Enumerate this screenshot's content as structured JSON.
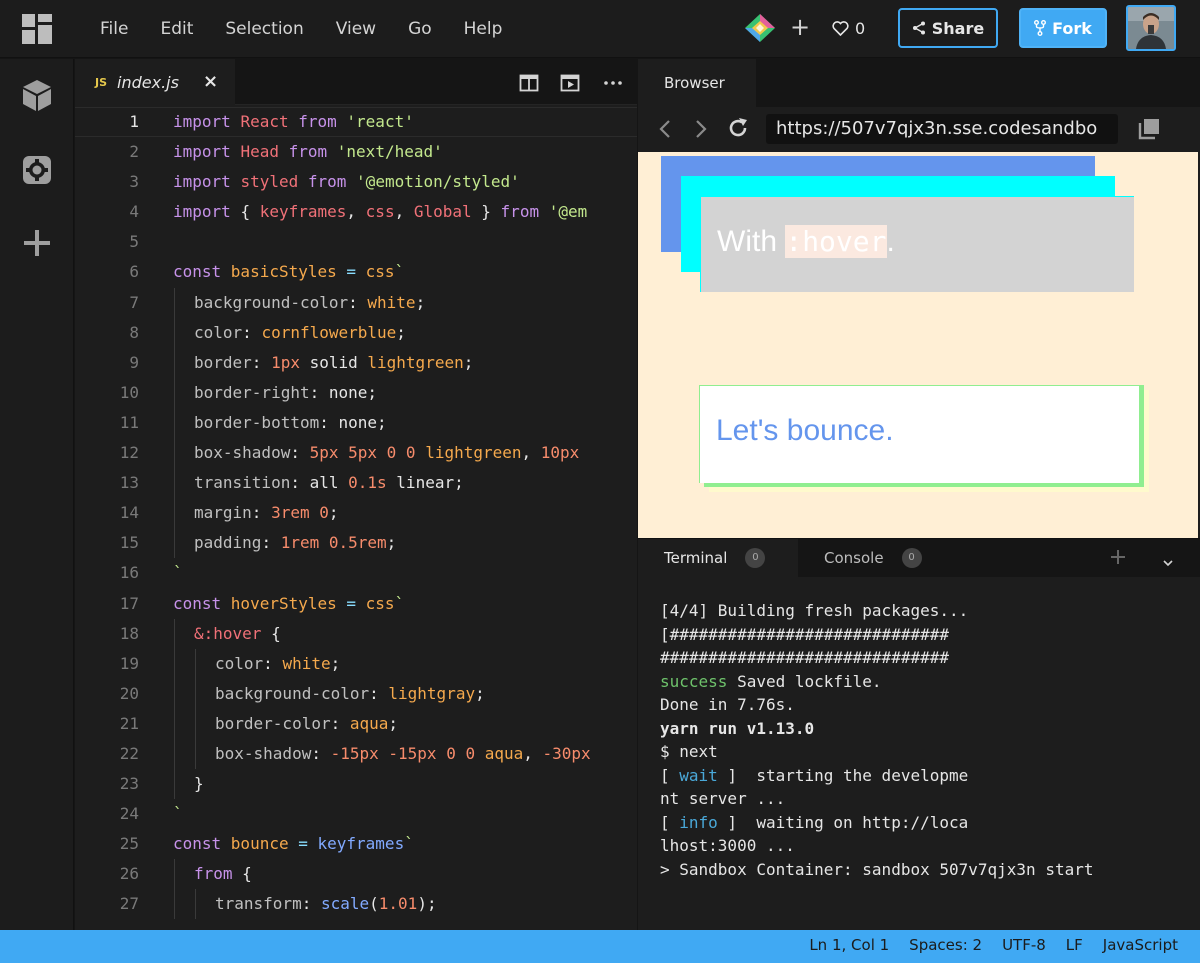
{
  "menu": [
    "File",
    "Edit",
    "Selection",
    "View",
    "Go",
    "Help"
  ],
  "header": {
    "plus": "+",
    "likes": "0",
    "share_label": "Share",
    "fork_label": "Fork"
  },
  "editor": {
    "tab": {
      "badge": "JS",
      "filename": "index.js",
      "close": "×"
    },
    "active_line": 1,
    "lines": [
      {
        "n": "1",
        "tokens": [
          {
            "c": "k",
            "t": "import "
          },
          {
            "c": "v",
            "t": "React "
          },
          {
            "c": "k",
            "t": "from "
          },
          {
            "c": "s",
            "t": "'react'"
          }
        ]
      },
      {
        "n": "2",
        "tokens": [
          {
            "c": "k",
            "t": "import "
          },
          {
            "c": "v",
            "t": "Head "
          },
          {
            "c": "k",
            "t": "from "
          },
          {
            "c": "s",
            "t": "'next/head'"
          }
        ]
      },
      {
        "n": "3",
        "tokens": [
          {
            "c": "k",
            "t": "import "
          },
          {
            "c": "v",
            "t": "styled "
          },
          {
            "c": "k",
            "t": "from "
          },
          {
            "c": "s",
            "t": "'@emotion/styled'"
          }
        ]
      },
      {
        "n": "4",
        "tokens": [
          {
            "c": "k",
            "t": "import "
          },
          {
            "c": "p",
            "t": "{ "
          },
          {
            "c": "v",
            "t": "keyframes"
          },
          {
            "c": "p",
            "t": ", "
          },
          {
            "c": "v",
            "t": "css"
          },
          {
            "c": "p",
            "t": ", "
          },
          {
            "c": "v",
            "t": "Global "
          },
          {
            "c": "p",
            "t": "} "
          },
          {
            "c": "k",
            "t": "from "
          },
          {
            "c": "s",
            "t": "'@em"
          }
        ]
      },
      {
        "n": "5",
        "tokens": []
      },
      {
        "n": "6",
        "tokens": [
          {
            "c": "k",
            "t": "const "
          },
          {
            "c": "val",
            "t": "basicStyles "
          },
          {
            "c": "o",
            "t": "= "
          },
          {
            "c": "val",
            "t": "css"
          },
          {
            "c": "s",
            "t": "`"
          }
        ]
      },
      {
        "n": "7",
        "indent": 1,
        "tokens": [
          {
            "c": "pr",
            "t": "background-color"
          },
          {
            "c": "p",
            "t": ": "
          },
          {
            "c": "val",
            "t": "white"
          },
          {
            "c": "p",
            "t": ";"
          }
        ]
      },
      {
        "n": "8",
        "indent": 1,
        "tokens": [
          {
            "c": "pr",
            "t": "color"
          },
          {
            "c": "p",
            "t": ": "
          },
          {
            "c": "val",
            "t": "cornflowerblue"
          },
          {
            "c": "p",
            "t": ";"
          }
        ]
      },
      {
        "n": "9",
        "indent": 1,
        "tokens": [
          {
            "c": "pr",
            "t": "border"
          },
          {
            "c": "p",
            "t": ": "
          },
          {
            "c": "n",
            "t": "1px "
          },
          {
            "c": "p",
            "t": "solid "
          },
          {
            "c": "val",
            "t": "lightgreen"
          },
          {
            "c": "p",
            "t": ";"
          }
        ]
      },
      {
        "n": "10",
        "indent": 1,
        "tokens": [
          {
            "c": "pr",
            "t": "border-right"
          },
          {
            "c": "p",
            "t": ": none;"
          }
        ]
      },
      {
        "n": "11",
        "indent": 1,
        "tokens": [
          {
            "c": "pr",
            "t": "border-bottom"
          },
          {
            "c": "p",
            "t": ": none;"
          }
        ]
      },
      {
        "n": "12",
        "indent": 1,
        "tokens": [
          {
            "c": "pr",
            "t": "box-shadow"
          },
          {
            "c": "p",
            "t": ": "
          },
          {
            "c": "n",
            "t": "5px 5px 0 0 "
          },
          {
            "c": "val",
            "t": "lightgreen"
          },
          {
            "c": "p",
            "t": ", "
          },
          {
            "c": "n",
            "t": "10px"
          }
        ]
      },
      {
        "n": "13",
        "indent": 1,
        "tokens": [
          {
            "c": "pr",
            "t": "transition"
          },
          {
            "c": "p",
            "t": ": all "
          },
          {
            "c": "n",
            "t": "0.1s "
          },
          {
            "c": "p",
            "t": "linear;"
          }
        ]
      },
      {
        "n": "14",
        "indent": 1,
        "tokens": [
          {
            "c": "pr",
            "t": "margin"
          },
          {
            "c": "p",
            "t": ": "
          },
          {
            "c": "n",
            "t": "3rem 0"
          },
          {
            "c": "p",
            "t": ";"
          }
        ]
      },
      {
        "n": "15",
        "indent": 1,
        "tokens": [
          {
            "c": "pr",
            "t": "padding"
          },
          {
            "c": "p",
            "t": ": "
          },
          {
            "c": "n",
            "t": "1rem 0.5rem"
          },
          {
            "c": "p",
            "t": ";"
          }
        ]
      },
      {
        "n": "16",
        "tokens": [
          {
            "c": "s",
            "t": "`"
          }
        ]
      },
      {
        "n": "17",
        "tokens": [
          {
            "c": "k",
            "t": "const "
          },
          {
            "c": "val",
            "t": "hoverStyles "
          },
          {
            "c": "o",
            "t": "= "
          },
          {
            "c": "val",
            "t": "css"
          },
          {
            "c": "s",
            "t": "`"
          }
        ]
      },
      {
        "n": "18",
        "indent": 1,
        "tokens": [
          {
            "c": "v",
            "t": "&:hover "
          },
          {
            "c": "p",
            "t": "{"
          }
        ]
      },
      {
        "n": "19",
        "indent": 2,
        "tokens": [
          {
            "c": "pr",
            "t": "color"
          },
          {
            "c": "p",
            "t": ": "
          },
          {
            "c": "val",
            "t": "white"
          },
          {
            "c": "p",
            "t": ";"
          }
        ]
      },
      {
        "n": "20",
        "indent": 2,
        "tokens": [
          {
            "c": "pr",
            "t": "background-color"
          },
          {
            "c": "p",
            "t": ": "
          },
          {
            "c": "val",
            "t": "lightgray"
          },
          {
            "c": "p",
            "t": ";"
          }
        ]
      },
      {
        "n": "21",
        "indent": 2,
        "tokens": [
          {
            "c": "pr",
            "t": "border-color"
          },
          {
            "c": "p",
            "t": ": "
          },
          {
            "c": "val",
            "t": "aqua"
          },
          {
            "c": "p",
            "t": ";"
          }
        ]
      },
      {
        "n": "22",
        "indent": 2,
        "tokens": [
          {
            "c": "pr",
            "t": "box-shadow"
          },
          {
            "c": "p",
            "t": ": "
          },
          {
            "c": "n",
            "t": "-15px -15px 0 0 "
          },
          {
            "c": "val",
            "t": "aqua"
          },
          {
            "c": "p",
            "t": ", "
          },
          {
            "c": "n",
            "t": "-30px"
          }
        ]
      },
      {
        "n": "23",
        "indent": 1,
        "tokens": [
          {
            "c": "p",
            "t": "}"
          }
        ]
      },
      {
        "n": "24",
        "tokens": [
          {
            "c": "s",
            "t": "`"
          }
        ]
      },
      {
        "n": "25",
        "tokens": [
          {
            "c": "k",
            "t": "const "
          },
          {
            "c": "val",
            "t": "bounce "
          },
          {
            "c": "o",
            "t": "= "
          },
          {
            "c": "f",
            "t": "keyframes"
          },
          {
            "c": "s",
            "t": "`"
          }
        ]
      },
      {
        "n": "26",
        "indent": 1,
        "tokens": [
          {
            "c": "k",
            "t": "from "
          },
          {
            "c": "p",
            "t": "{"
          }
        ]
      },
      {
        "n": "27",
        "indent": 2,
        "tokens": [
          {
            "c": "pr",
            "t": "transform"
          },
          {
            "c": "p",
            "t": ": "
          },
          {
            "c": "f",
            "t": "scale"
          },
          {
            "c": "p",
            "t": "("
          },
          {
            "c": "n",
            "t": "1.01"
          },
          {
            "c": "p",
            "t": ");"
          }
        ]
      }
    ]
  },
  "browser": {
    "tab_label": "Browser",
    "url": "https://507v7qjx3n.sse.codesandbo",
    "preview": {
      "hover_text": "With ",
      "hover_code": ":hover",
      "hover_period": ".",
      "bounce_text": "Let's bounce."
    }
  },
  "terminal": {
    "tab_terminal": "Terminal",
    "tab_console": "Console",
    "terminal_count": "0",
    "console_count": "0",
    "lines": [
      [
        {
          "c": "",
          "t": "[4/4] Building fresh packages..."
        }
      ],
      [
        {
          "c": "",
          "t": "[#############################"
        }
      ],
      [
        {
          "c": "",
          "t": "##############################"
        }
      ],
      [
        {
          "c": "green",
          "t": "success"
        },
        {
          "c": "",
          "t": " Saved lockfile."
        }
      ],
      [
        {
          "c": "",
          "t": "Done in 7.76s."
        }
      ],
      [
        {
          "c": "bold",
          "t": "yarn run v1.13.0"
        }
      ],
      [
        {
          "c": "",
          "t": "$ next"
        }
      ],
      [
        {
          "c": "",
          "t": "[ "
        },
        {
          "c": "cyan",
          "t": "wait"
        },
        {
          "c": "",
          "t": " ]  starting the developme"
        }
      ],
      [
        {
          "c": "",
          "t": "nt server ..."
        }
      ],
      [
        {
          "c": "",
          "t": "[ "
        },
        {
          "c": "cyan",
          "t": "info"
        },
        {
          "c": "",
          "t": " ]  waiting on http://loca"
        }
      ],
      [
        {
          "c": "",
          "t": "lhost:3000 ..."
        }
      ],
      [
        {
          "c": "",
          "t": "> Sandbox Container: sandbox 507v7qjx3n start"
        }
      ]
    ]
  },
  "status": {
    "position": "Ln 1, Col 1",
    "spaces": "Spaces: 2",
    "encoding": "UTF-8",
    "eol": "LF",
    "language": "JavaScript"
  },
  "colors": {
    "accent": "#40a9f3",
    "preview_bg": "#ffefd5"
  }
}
